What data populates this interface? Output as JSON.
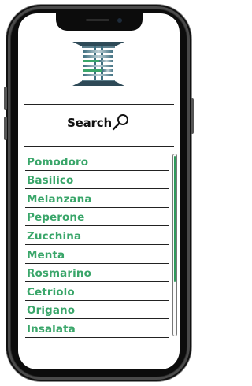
{
  "header": {
    "logo_icon": "server-rack-logo-icon",
    "accent_color": "#3aa66a"
  },
  "search": {
    "label": "Search",
    "icon": "magnifier-icon"
  },
  "list": {
    "items": [
      {
        "label": "Pomodoro"
      },
      {
        "label": "Basilico"
      },
      {
        "label": "Melanzana"
      },
      {
        "label": "Peperone"
      },
      {
        "label": "Zucchina"
      },
      {
        "label": "Menta"
      },
      {
        "label": "Rosmarino"
      },
      {
        "label": "Cetriolo"
      },
      {
        "label": "Origano"
      },
      {
        "label": "Insalata"
      }
    ]
  },
  "scroll": {
    "position": 0,
    "visible_fraction": 0.7
  }
}
